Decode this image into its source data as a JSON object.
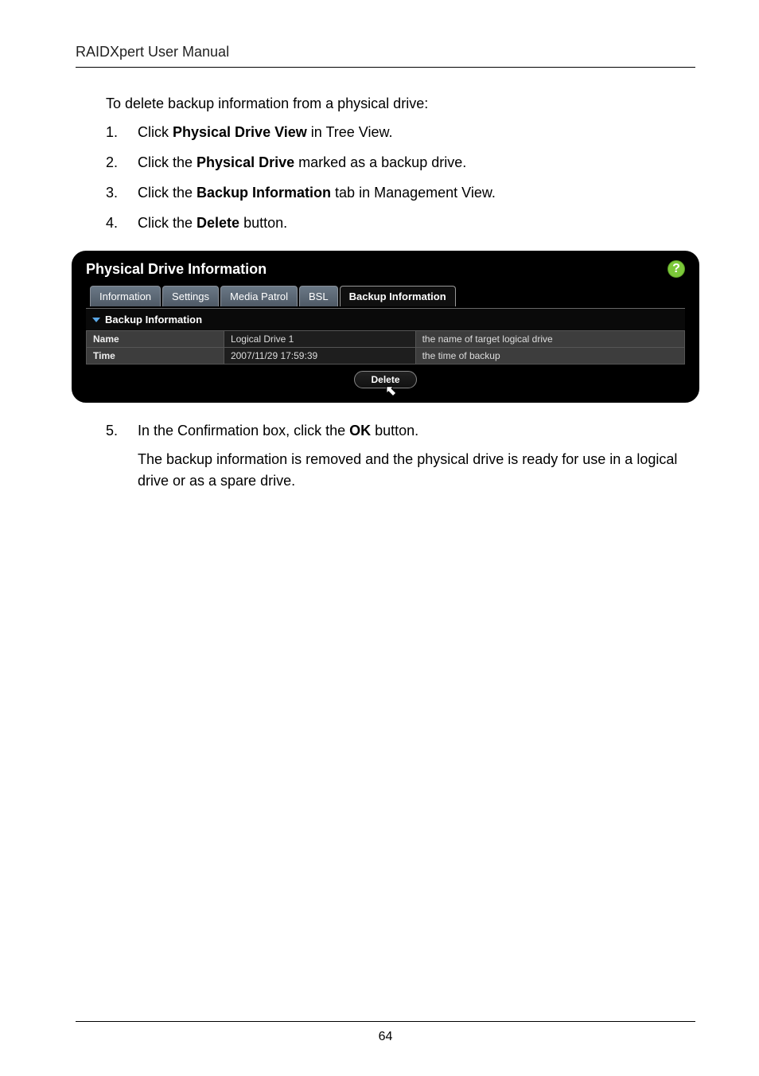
{
  "header": {
    "title": "RAIDXpert User Manual"
  },
  "intro": "To delete backup information from a physical drive:",
  "steps": [
    {
      "num": "1.",
      "pre": "Click ",
      "bold": "Physical Drive View",
      "post": " in Tree View."
    },
    {
      "num": "2.",
      "pre": "Click the ",
      "bold": "Physical Drive",
      "post": " marked as a backup drive."
    },
    {
      "num": "3.",
      "pre": "Click the ",
      "bold": "Backup Information",
      "post": " tab in Management View."
    },
    {
      "num": "4.",
      "pre": "Click the ",
      "bold": "Delete",
      "post": " button."
    }
  ],
  "panel": {
    "title": "Physical Drive Information",
    "help": "?",
    "tabs": {
      "information": "Information",
      "settings": "Settings",
      "media_patrol": "Media Patrol",
      "bsl": "BSL",
      "backup_information": "Backup Information"
    },
    "section_label": "Backup Information",
    "rows": [
      {
        "label": "Name",
        "value": "Logical Drive 1",
        "desc": "the name of target logical drive"
      },
      {
        "label": "Time",
        "value": "2007/11/29 17:59:39",
        "desc": "the time of backup"
      }
    ],
    "delete_label": "Delete"
  },
  "step5": {
    "num": "5.",
    "line1_pre": "In the Confirmation box, click the ",
    "line1_bold": "OK",
    "line1_post": " button.",
    "line2": "The backup information is removed and the physical drive is ready for use in a logical drive or as a spare drive."
  },
  "page_number": "64"
}
